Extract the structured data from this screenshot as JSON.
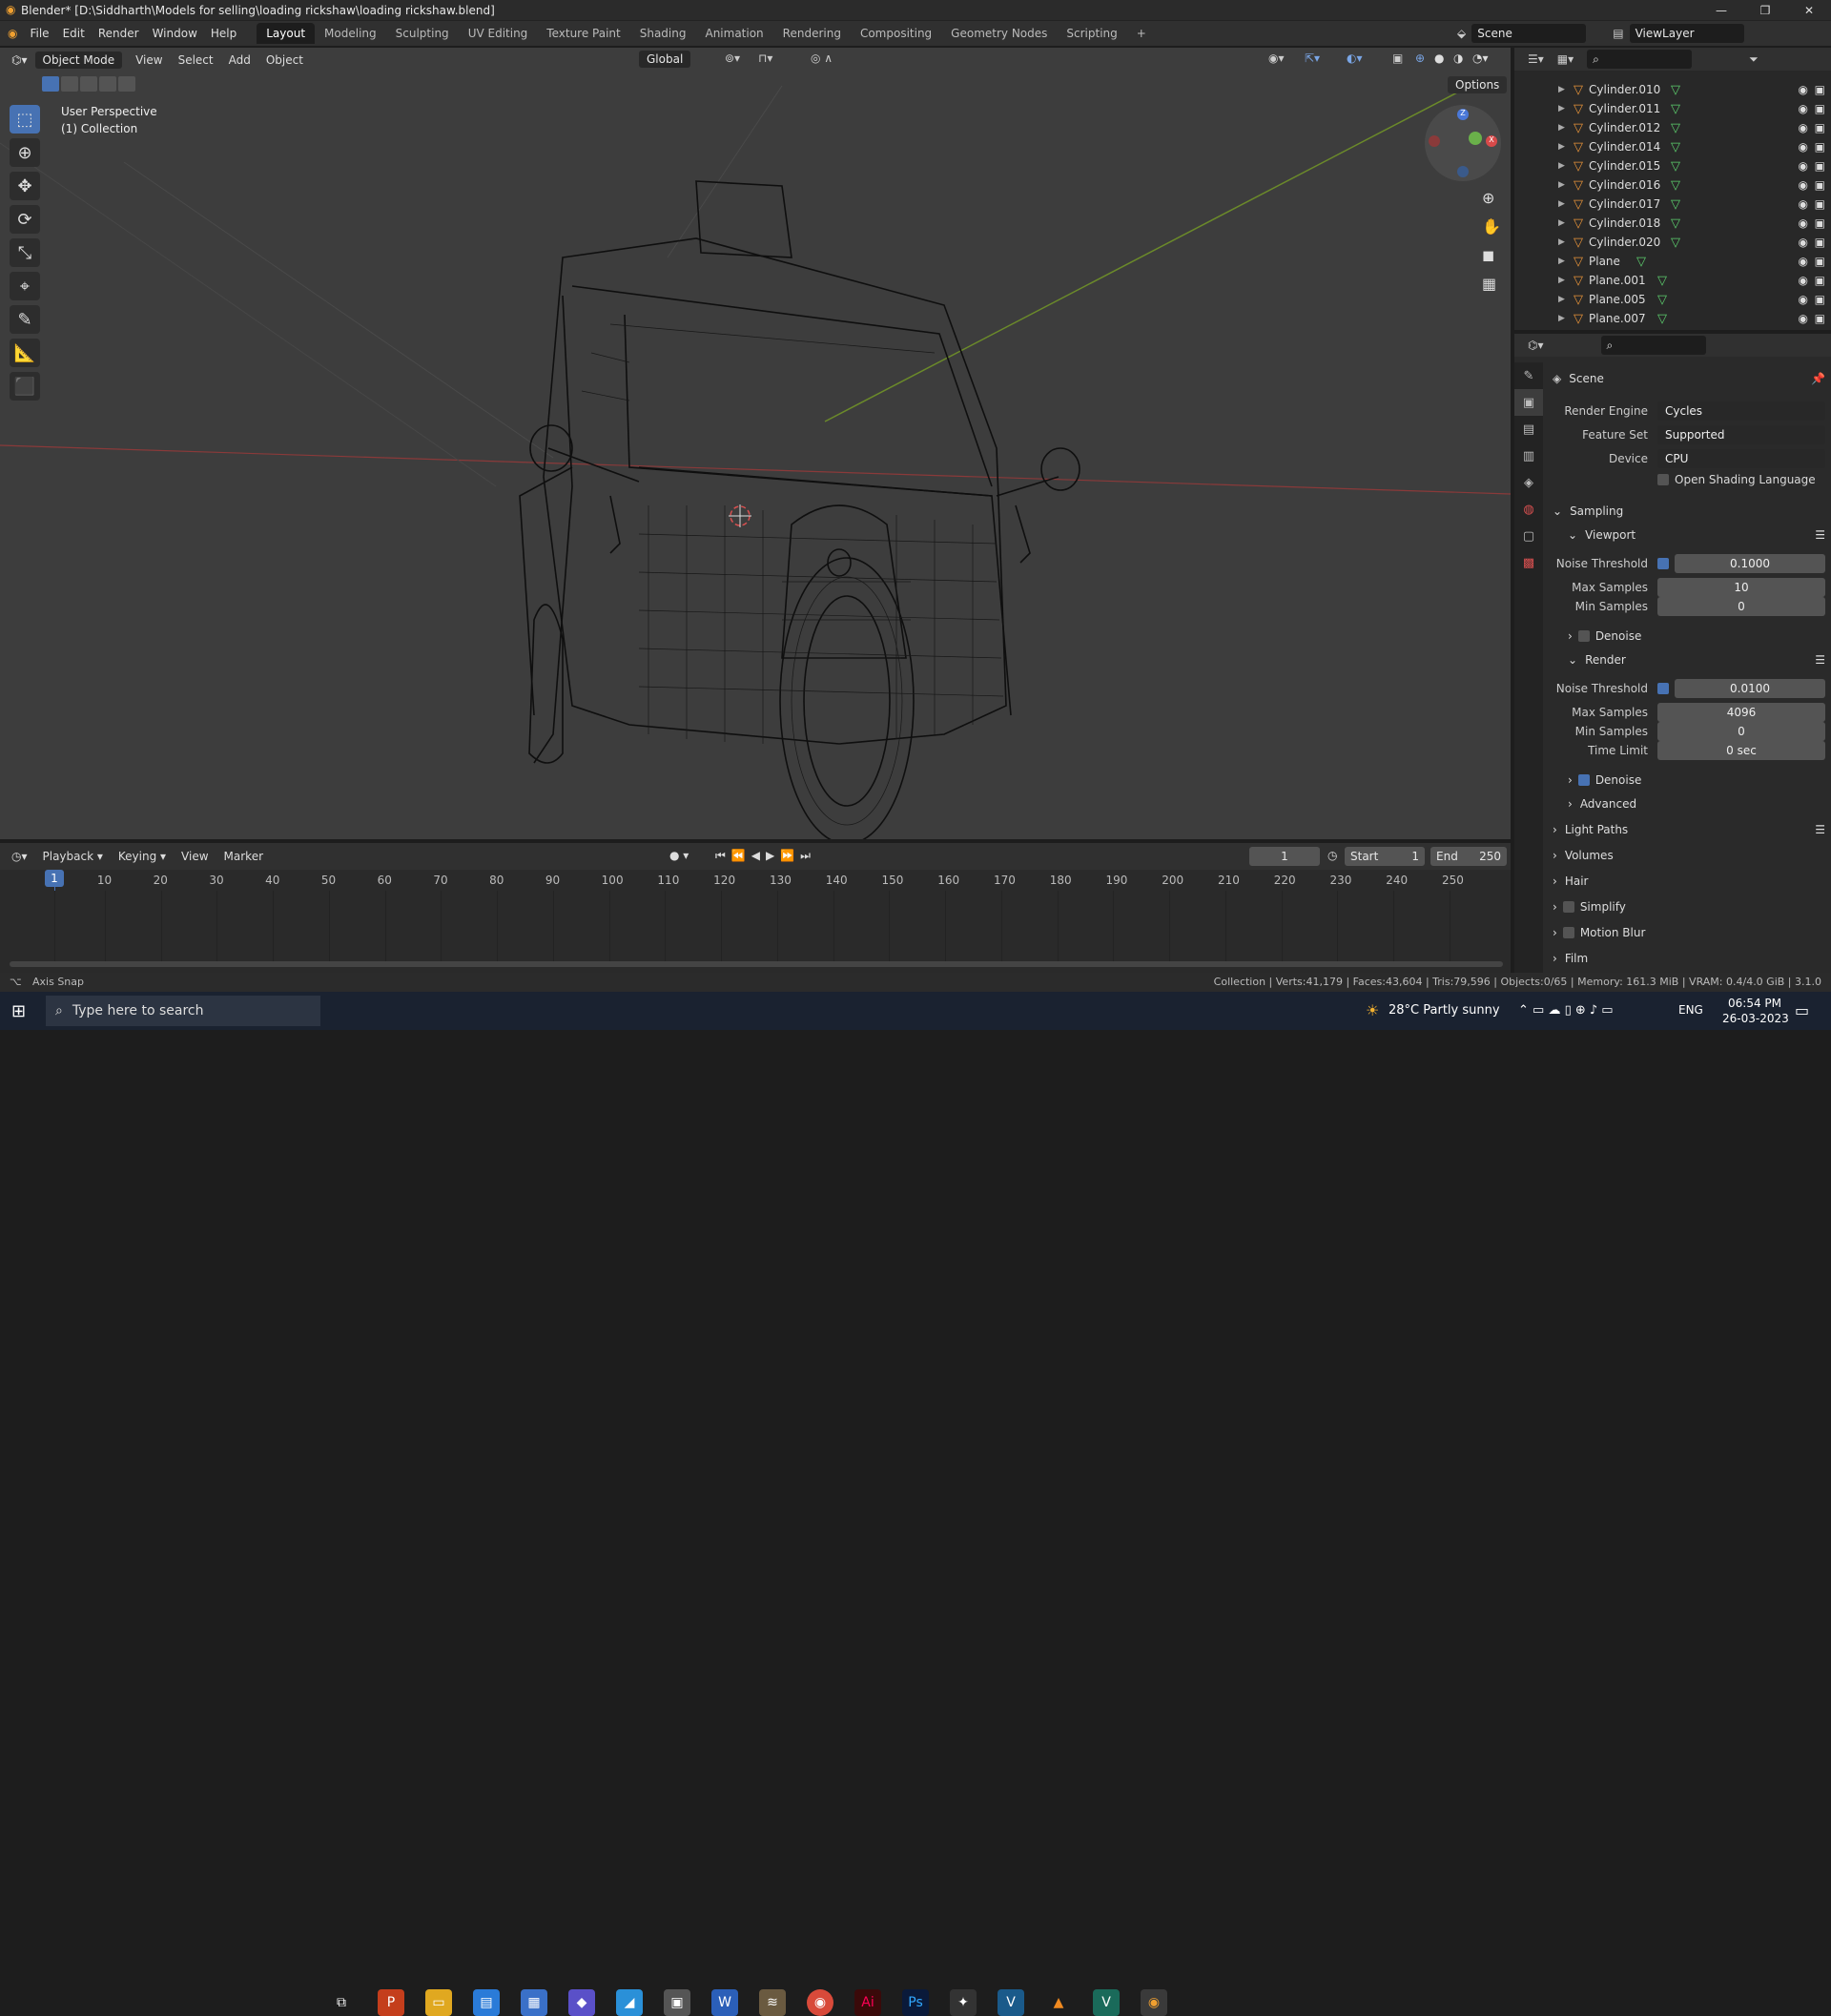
{
  "window": {
    "title": "Blender* [D:\\Siddharth\\Models for selling\\loading rickshaw\\loading rickshaw.blend]",
    "controls": [
      "—",
      "❐",
      "✕"
    ]
  },
  "menu": [
    "File",
    "Edit",
    "Render",
    "Window",
    "Help"
  ],
  "workspaces": [
    "Layout",
    "Modeling",
    "Sculpting",
    "UV Editing",
    "Texture Paint",
    "Shading",
    "Animation",
    "Rendering",
    "Compositing",
    "Geometry Nodes",
    "Scripting",
    "+"
  ],
  "scene": {
    "scene_name": "Scene",
    "view_layer": "ViewLayer"
  },
  "viewport": {
    "mode": "Object Mode",
    "menus": [
      "View",
      "Select",
      "Add",
      "Object"
    ],
    "orientation": "Global",
    "options": "Options",
    "perspective": "User Perspective",
    "collection": "(1) Collection"
  },
  "outliner": {
    "items": [
      "Cylinder.010",
      "Cylinder.011",
      "Cylinder.012",
      "Cylinder.014",
      "Cylinder.015",
      "Cylinder.016",
      "Cylinder.017",
      "Cylinder.018",
      "Cylinder.020",
      "Plane",
      "Plane.001",
      "Plane.005",
      "Plane.007"
    ]
  },
  "properties": {
    "context": "Scene",
    "render_engine_label": "Render Engine",
    "render_engine": "Cycles",
    "feature_set_label": "Feature Set",
    "feature_set": "Supported",
    "device_label": "Device",
    "device": "CPU",
    "osl": "Open Shading Language",
    "sampling": "Sampling",
    "viewport": "Viewport",
    "noise_threshold_label": "Noise Threshold",
    "vp_noise": "0.1000",
    "max_samples_label": "Max Samples",
    "vp_max": "10",
    "min_samples_label": "Min Samples",
    "vp_min": "0",
    "denoise": "Denoise",
    "render": "Render",
    "r_noise": "0.0100",
    "r_max": "4096",
    "r_min": "0",
    "time_limit_label": "Time Limit",
    "r_time": "0 sec",
    "advanced": "Advanced",
    "light_paths": "Light Paths",
    "volumes": "Volumes",
    "hair": "Hair",
    "simplify": "Simplify",
    "motion_blur": "Motion Blur",
    "film": "Film"
  },
  "timeline": {
    "menus": [
      "Playback",
      "Keying",
      "View",
      "Marker"
    ],
    "current": "1",
    "start_label": "Start",
    "start": "1",
    "end_label": "End",
    "end": "250",
    "ticks": [
      "1",
      "10",
      "20",
      "30",
      "40",
      "50",
      "60",
      "70",
      "80",
      "90",
      "100",
      "110",
      "120",
      "130",
      "140",
      "150",
      "160",
      "170",
      "180",
      "190",
      "200",
      "210",
      "220",
      "230",
      "240",
      "250"
    ]
  },
  "status": {
    "left": "Axis Snap",
    "right": "Collection | Verts:41,179 | Faces:43,604 | Tris:79,596 | Objects:0/65 | Memory: 161.3 MiB | VRAM: 0.4/4.0 GiB | 3.1.0"
  },
  "taskbar": {
    "search": "Type here to search",
    "weather": "28°C Partly sunny",
    "lang": "ENG",
    "time": "06:54 PM",
    "date": "26-03-2023"
  }
}
